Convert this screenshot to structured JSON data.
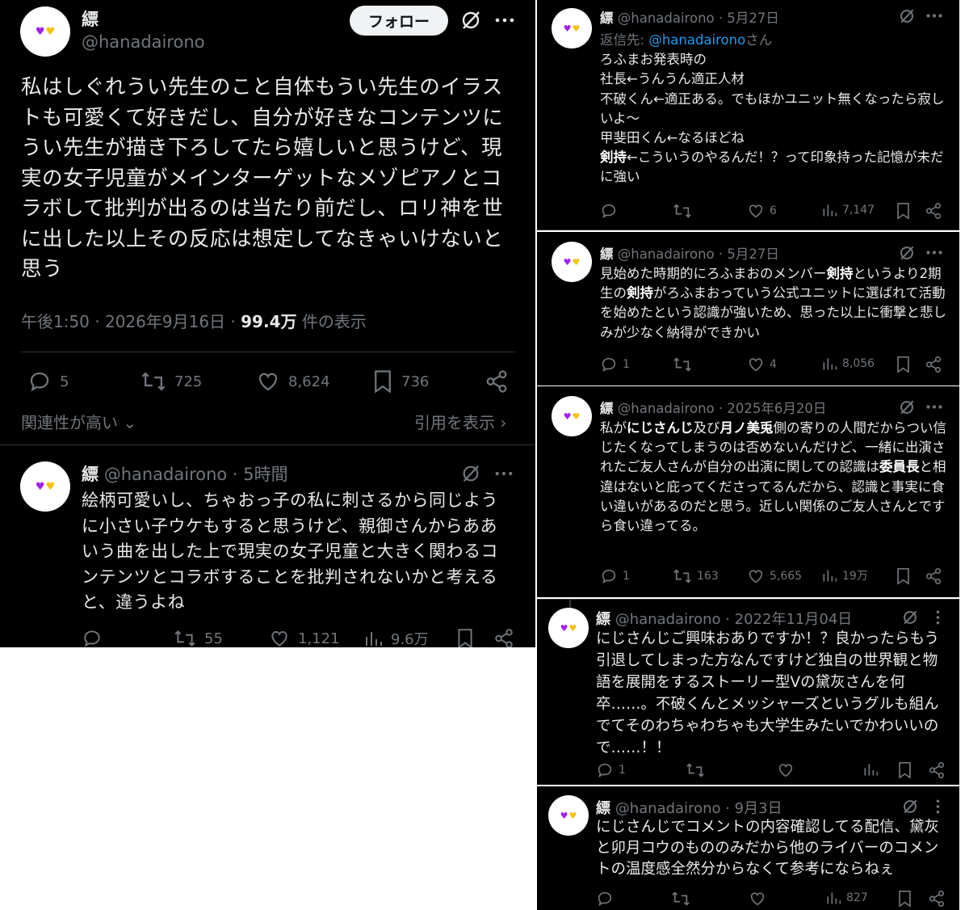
{
  "main_tweet": {
    "display_name": "縹",
    "handle": "@hanadairono",
    "follow_label": "フォロー",
    "text": "私はしぐれうい先生のこと自体もうい先生のイラストも可愛くて好きだし、自分が好きなコンテンツにうい先生が描き下ろしてたら嬉しいと思うけど、現実の女子児童がメインターゲットなメゾピアノとコラボして批判が出るのは当たり前だし、ロリ神を世に出した以上その反応は想定してなきゃいけないと思う",
    "time": "午後1:50 · 2026年9月16日 · ",
    "views_bold": "99.4万",
    "views_suffix": " 件の表示",
    "replies": "5",
    "retweets": "725",
    "likes": "8,624",
    "bookmarks": "736",
    "sort_label": "関連性が高い",
    "quotes_label": "引用を表示"
  },
  "reply_tweet": {
    "display_name": "縹",
    "handle_time": "@hanadairono · 5時間",
    "text": "絵柄可愛いし、ちゃおっ子の私に刺さるから同じように小さい子ウケもすると思うけど、親御さんからああいう曲を出した上で現実の女子児童と大きく関わるコンテンツとコラボすることを批判されないかと考えると、違うよね",
    "retweets": "55",
    "likes": "1,121",
    "views": "9.6万"
  },
  "right_posts": [
    {
      "display_name": "縹",
      "handle_time": "@hanadairono · 5月27日",
      "reply_prefix": "返信先: ",
      "reply_to": "@hanadairono",
      "reply_suffix": "さん",
      "lines": [
        "ろふまお発表時の",
        "社長←うんうん適正人材",
        "不破くん←適正ある。でもほかユニット無くなったら寂しいよ〜",
        "甲斐田くん←なるほどね"
      ],
      "bold_word": "剣持",
      "last_line": "←こういうのやるんだ！？って印象持った記憶が未だに強い",
      "replies": "",
      "retweets": "",
      "likes": "6",
      "views": "7,147"
    },
    {
      "display_name": "縹",
      "handle_time": "@hanadairono · 5月27日",
      "text_a": "見始めた時期的にろふまおのメンバー",
      "bold_a": "剣持",
      "text_b": "というより2期生の",
      "bold_b": "剣持",
      "text_c": "がろふまおっていう公式ユニットに選ばれて活動を始めたという認識が強いため、思った以上に衝撃と悲しみが少なく納得ができかい",
      "replies": "1",
      "retweets": "",
      "likes": "4",
      "views": "8,056"
    },
    {
      "display_name": "縹",
      "handle_time": "@hanadairono · 2025年6月20日",
      "text_a": "私が",
      "bold_a": "にじさんじ",
      "text_b": "及び",
      "bold_b": "月ノ美兎",
      "text_c": "側の寄りの人間だからつい信じたくなってしまうのは否めないんだけど、一緒に出演されたご友人さんが自分の出演に関しての認識は",
      "bold_c": "委員長",
      "text_d": "と相違はないと庇ってくださってるんだから、認識と事実に食い違いがあるのだと思う。近しい関係のご友人さんとですら食い違ってる。",
      "replies": "1",
      "retweets": "163",
      "likes": "5,665",
      "views": "19万"
    },
    {
      "display_name": "縹",
      "handle_time": "@hanadairono · 2022年11月04日",
      "text": "にじさんじご興味おありですか！？良かったらもう引退してしまった方なんですけど独自の世界観と物語を展開をするストーリー型Vの黛灰さんを何卒……。不破くんとメッシャーズというグルも組んでてそのわちゃわちゃも大学生みたいでかわいいので……！！",
      "replies": "1"
    },
    {
      "display_name": "縹",
      "handle_time": "@hanadairono · 9月3日",
      "text": "にじさんじでコメントの内容確認してる配信、黛灰と卯月コウのもののみだから他のライバーのコメントの温度感全然分からなくて参考にならねぇ",
      "views": "827"
    }
  ],
  "colors": {
    "background": "#000000",
    "text": "#e7e9ea",
    "muted": "#71767b",
    "link": "#1d9bf0",
    "follow_bg": "#eff3f4",
    "divider": "#2f3336"
  }
}
